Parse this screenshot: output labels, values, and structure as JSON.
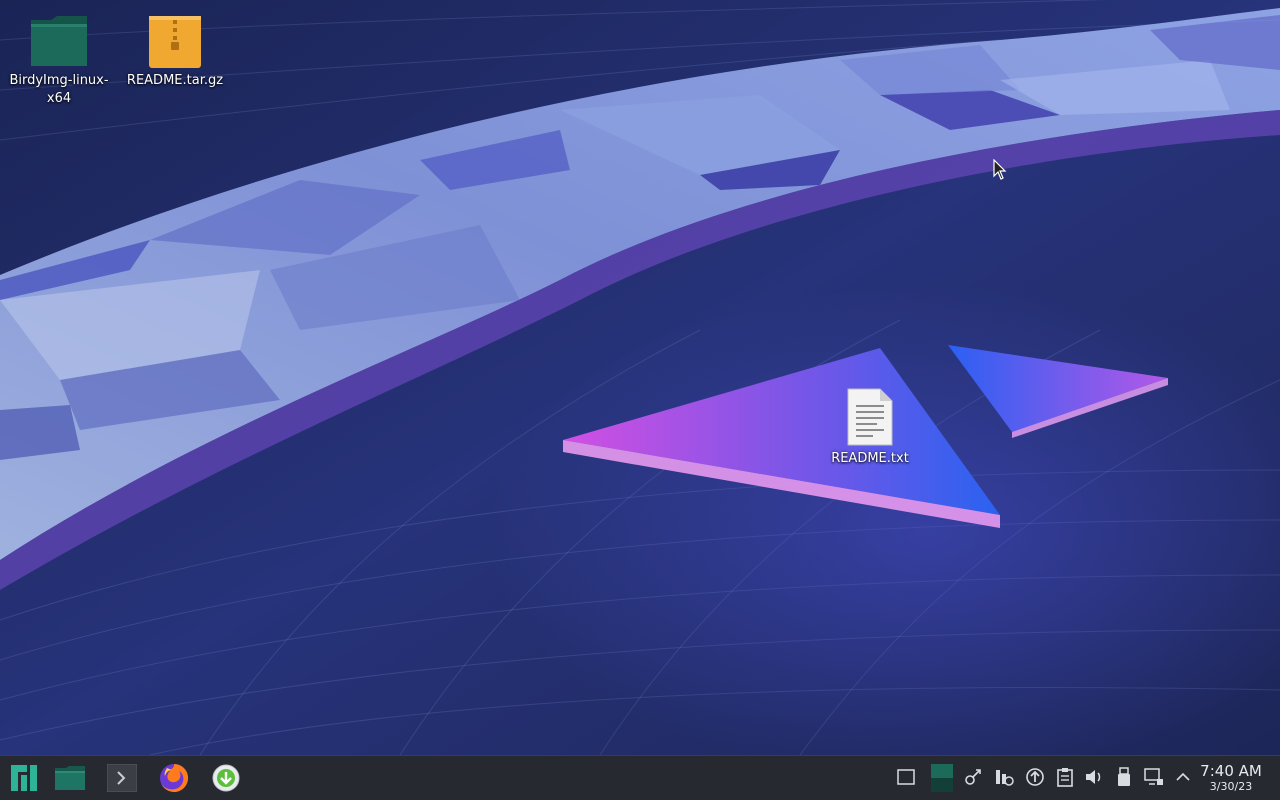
{
  "desktop": {
    "icons": [
      {
        "label": "BirdyImg-linux-x64",
        "type": "folder-icon"
      },
      {
        "label": "README.tar.gz",
        "type": "archive-icon"
      },
      {
        "label": "README.txt",
        "type": "text-file-icon"
      }
    ]
  },
  "taskbar": {
    "launchers": [
      "manjaro-menu-icon",
      "file-manager-icon",
      "terminal-icon",
      "firefox-icon",
      "downloader-icon"
    ],
    "tray": [
      "show-desktop-icon",
      "pager-icon",
      "kde-connect-icon",
      "activity-icon",
      "update-icon",
      "clipboard-icon",
      "volume-icon",
      "usb-device-icon",
      "network-icon",
      "expand-tray-icon"
    ],
    "clock": {
      "time": "7:40 AM",
      "date": "3/30/23"
    }
  },
  "colors": {
    "taskbar_bg": "#262a30",
    "folder": "#1c6a5a",
    "archive": "#f0a830",
    "accent": "#2eb398"
  }
}
